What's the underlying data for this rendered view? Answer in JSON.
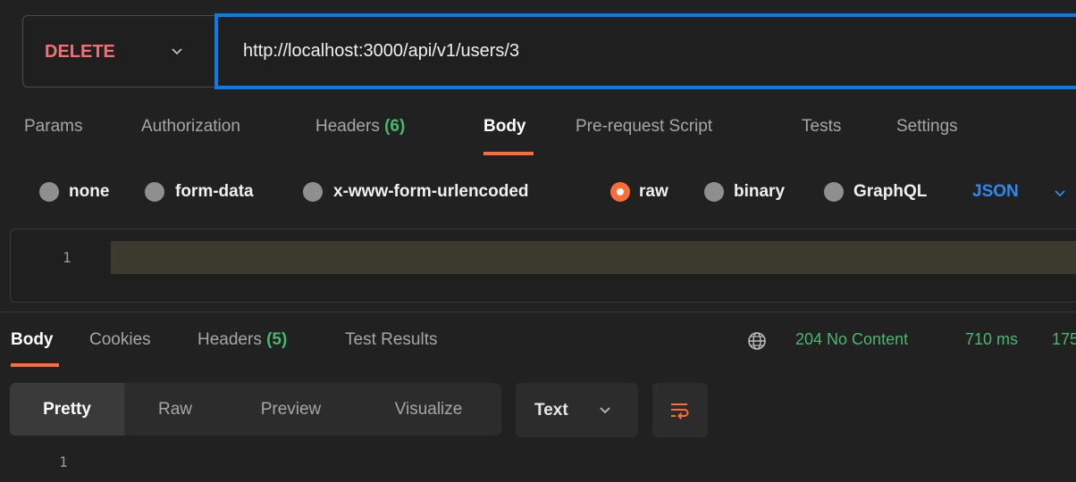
{
  "request": {
    "method": "DELETE",
    "url": "http://localhost:3000/api/v1/users/3"
  },
  "request_tabs": {
    "params": "Params",
    "authorization": "Authorization",
    "headers": "Headers",
    "headers_count": "(6)",
    "body": "Body",
    "pre_request": "Pre-request Script",
    "tests": "Tests",
    "settings": "Settings"
  },
  "body_types": {
    "none": "none",
    "form_data": "form-data",
    "urlencoded": "x-www-form-urlencoded",
    "raw": "raw",
    "binary": "binary",
    "graphql": "GraphQL",
    "selected": "raw",
    "language": "JSON"
  },
  "editor": {
    "line_number": "1"
  },
  "response_tabs": {
    "body": "Body",
    "cookies": "Cookies",
    "headers": "Headers",
    "headers_count": "(5)",
    "test_results": "Test Results"
  },
  "response_status": {
    "status": "204 No Content",
    "time": "710 ms",
    "size_partial": "175"
  },
  "response_view": {
    "pretty": "Pretty",
    "raw": "Raw",
    "preview": "Preview",
    "visualize": "Visualize",
    "format": "Text",
    "line_number": "1"
  },
  "colors": {
    "accent": "#ff6c37",
    "url_focus": "#0a7ce8",
    "method_delete": "#f07178",
    "status_ok": "#49b86e",
    "language": "#2d8bf0"
  },
  "icons": {
    "method_dropdown": "chevron-down-icon",
    "language_dropdown": "chevron-down-icon",
    "network": "globe-icon",
    "wrap": "wrap-lines-icon"
  }
}
